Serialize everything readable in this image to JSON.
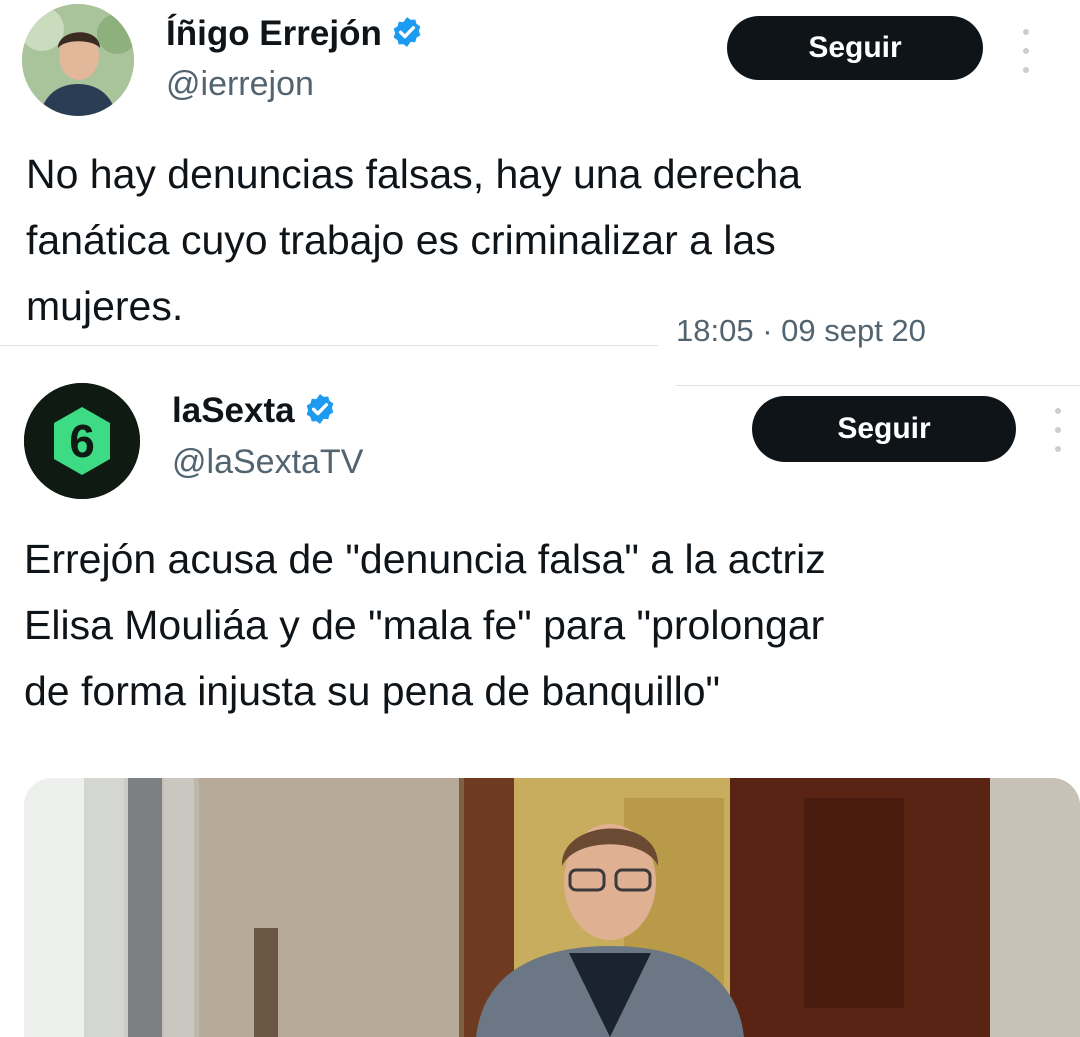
{
  "tweet1": {
    "author_name": "Íñigo Errejón",
    "handle": "@ierrejon",
    "follow_label": "Seguir",
    "text_lines": [
      "No hay denuncias falsas, hay una derecha",
      "fanática cuyo trabajo es criminalizar a las",
      "mujeres."
    ],
    "timestamp": "18:05 · 09 sept 20"
  },
  "tweet2": {
    "author_name": "laSexta",
    "handle": "@laSextaTV",
    "follow_label": "Seguir",
    "text_lines": [
      "Errejón acusa de \"denuncia falsa\" a la actriz",
      "Elisa Mouliáa y de \"mala fe\" para \"prolongar",
      "de forma injusta su pena de banquillo\""
    ],
    "logo_glyph": "6"
  },
  "colors": {
    "verified": "#1d9bf0",
    "button_bg": "#0f1419",
    "handle": "#536471",
    "lasexta_green": "#3ddc84"
  },
  "icons": {
    "verified": "verified-badge-icon",
    "more": "more-options-icon"
  }
}
